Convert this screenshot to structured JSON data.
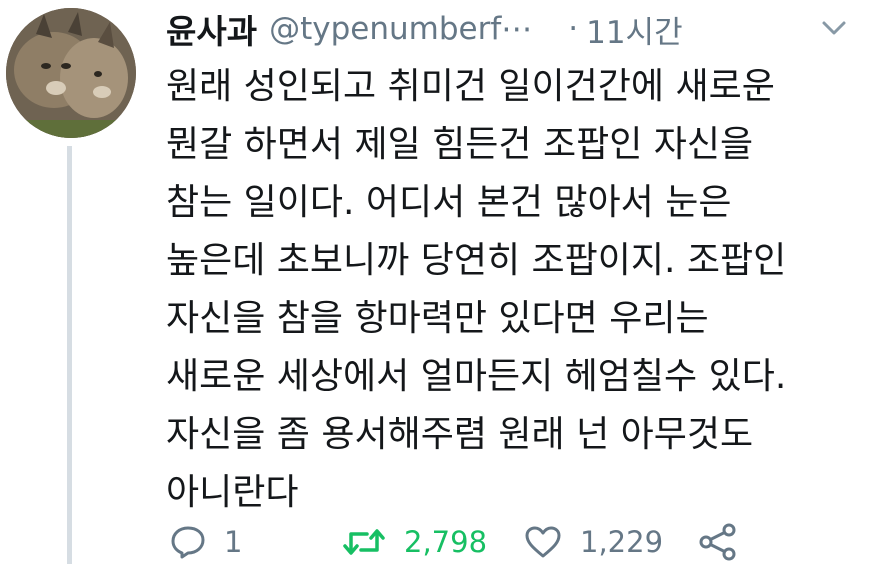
{
  "user": {
    "display_name": "윤사과",
    "handle": "@typenumberf⋯",
    "dot": "·",
    "time": "11시간"
  },
  "tweet": {
    "lines": [
      "원래 성인되고 취미건 일이건간에 새로운",
      "뭔갈 하면서 제일 힘든건 조팝인 자신을",
      "참는 일이다. 어디서 본건 많아서 눈은",
      "높은데 초보니까 당연히 조팝이지. 조팝인",
      "자신을 참을 항마력만 있다면 우리는",
      "새로운 세상에서 얼마든지 헤엄칠수 있다.",
      "자신을 좀 용서해주렴 원래 넌 아무것도",
      "아니란다"
    ]
  },
  "actions": {
    "reply_count": "1",
    "retweet_count": "2,798",
    "like_count": "1,229"
  },
  "icons": {
    "reply": "reply-icon",
    "retweet": "retweet-icon",
    "like": "heart-icon",
    "share": "share-icon",
    "menu": "chevron-down-icon"
  },
  "colors": {
    "text": "#14171a",
    "muted": "#657786",
    "retweet": "#17bf63",
    "thread_line": "#d6dde3"
  }
}
